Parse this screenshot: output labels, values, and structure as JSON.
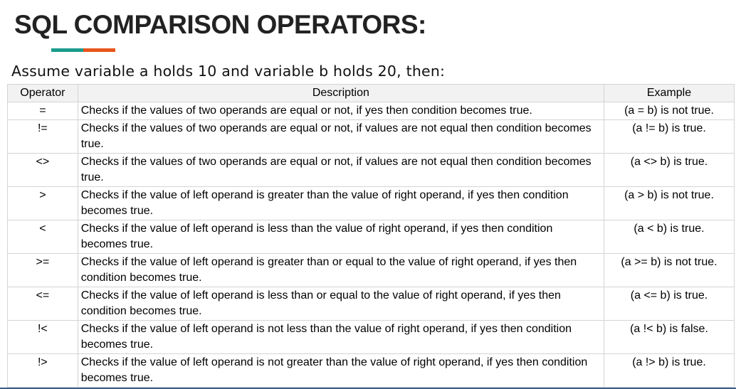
{
  "title": "SQL COMPARISON OPERATORS:",
  "subtitle": "Assume variable a holds 10 and variable b holds 20, then:",
  "colors": {
    "accent_teal": "#1a9b8c",
    "accent_orange": "#e8551b",
    "header_bg": "#f2f2f2"
  },
  "table": {
    "headers": {
      "operator": "Operator",
      "description": "Description",
      "example": "Example"
    },
    "rows": [
      {
        "op": "=",
        "desc": "Checks if the values of two operands are equal or not, if yes then condition becomes true.",
        "ex": "(a = b) is not true."
      },
      {
        "op": "!=",
        "desc": "Checks if the values of two operands are equal or not, if values are not equal then condition becomes true.",
        "ex": "(a != b) is true."
      },
      {
        "op": "<>",
        "desc": "Checks if the values of two operands are equal or not, if values are not equal then condition becomes true.",
        "ex": "(a <> b) is true."
      },
      {
        "op": ">",
        "desc": "Checks if the value of left operand is greater than the value of right operand, if yes then condition becomes true.",
        "ex": "(a > b) is not true."
      },
      {
        "op": "<",
        "desc": "Checks if the value of left operand is less than the value of right operand, if yes then condition becomes true.",
        "ex": "(a < b) is true."
      },
      {
        "op": ">=",
        "desc": "Checks if the value of left operand is greater than or equal to the value of right operand, if yes then condition becomes true.",
        "ex": "(a >= b) is not true."
      },
      {
        "op": "<=",
        "desc": "Checks if the value of left operand is less than or equal to the value of right operand, if yes then condition becomes true.",
        "ex": "(a <= b) is true."
      },
      {
        "op": "!<",
        "desc": "Checks if the value of left operand is not less than the value of right operand, if yes then condition becomes true.",
        "ex": "(a !< b) is false."
      },
      {
        "op": "!>",
        "desc": "Checks if the value of left operand is not greater than the value of right operand, if yes then condition becomes true.",
        "ex": "(a !> b) is true."
      }
    ]
  }
}
